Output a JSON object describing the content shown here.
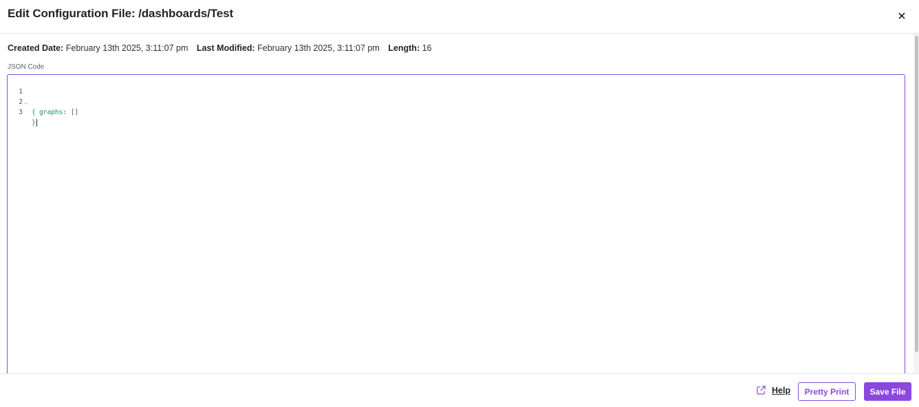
{
  "dialog": {
    "title": "Edit Configuration File: /dashboards/Test",
    "close_icon": "close-icon"
  },
  "meta": {
    "created_label": "Created Date:",
    "created_value": "February 13th 2025, 3:11:07 pm",
    "modified_label": "Last Modified:",
    "modified_value": "February 13th 2025, 3:11:07 pm",
    "length_label": "Length:",
    "length_value": "16"
  },
  "editor": {
    "label": "JSON Code",
    "lines": [
      {
        "num": "1",
        "text": "{"
      },
      {
        "num": "2",
        "key": "graphs",
        "colon": ":",
        "value": "[]"
      },
      {
        "num": "3",
        "text": "}"
      }
    ]
  },
  "footer": {
    "help_label": "Help",
    "help_icon": "external-link-icon",
    "pretty_print_label": "Pretty Print",
    "save_label": "Save File"
  },
  "colors": {
    "accent": "#8b47e0",
    "json_key": "#1a8f5e"
  }
}
